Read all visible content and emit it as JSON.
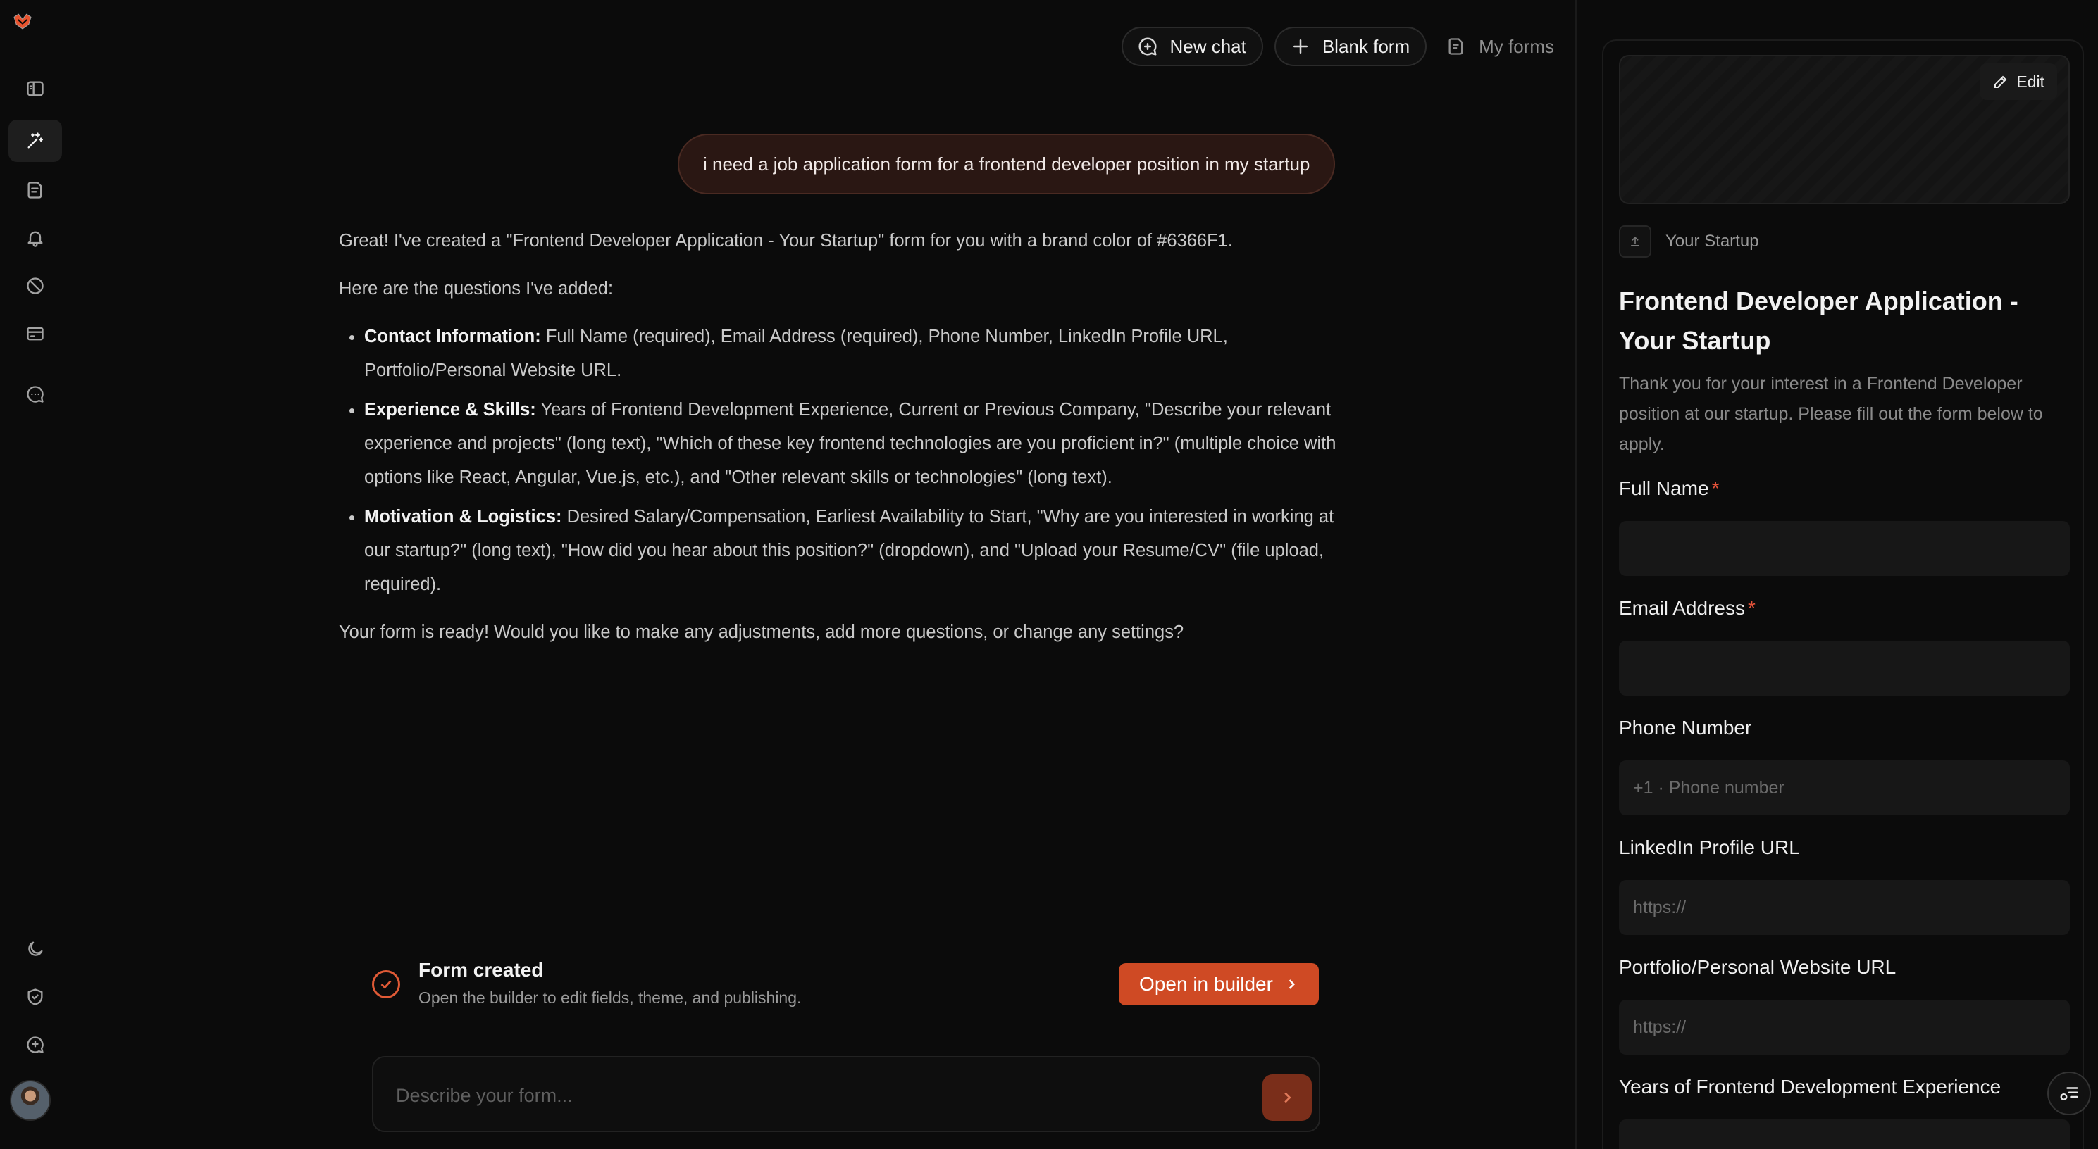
{
  "app": {
    "accent_color": "#cf4a24",
    "logo_icon": "brand-logo"
  },
  "rail": {
    "items": [
      "sidebar-toggle-icon",
      "ai-sparkle-icon",
      "forms-icon",
      "bell-icon",
      "slash-tag-icon",
      "card-icon",
      "chat-bubble-icon"
    ],
    "bottom_items": [
      "moon-icon",
      "shield-check-icon",
      "feedback-icon"
    ],
    "active_index": 1
  },
  "topbar": {
    "new_chat": "New chat",
    "blank_form": "Blank form",
    "my_forms": "My forms"
  },
  "chat": {
    "user_message": "i need a job application form for a frontend developer position in my startup",
    "intro": "Great! I've created a \"Frontend Developer Application - Your Startup\" form for you with a brand color of #6366F1.",
    "questions_heading": "Here are the questions I've added:",
    "sections": [
      {
        "title": "Contact Information:",
        "text": " Full Name (required), Email Address (required), Phone Number, LinkedIn Profile URL, Portfolio/Personal Website URL."
      },
      {
        "title": "Experience & Skills:",
        "text": " Years of Frontend Development Experience, Current or Previous Company, \"Describe your relevant experience and projects\" (long text), \"Which of these key frontend technologies are you proficient in?\" (multiple choice with options like React, Angular, Vue.js, etc.), and \"Other relevant skills or technologies\" (long text)."
      },
      {
        "title": "Motivation & Logistics:",
        "text": " Desired Salary/Compensation, Earliest Availability to Start, \"Why are you interested in working at our startup?\" (long text), \"How did you hear about this position?\" (dropdown), and \"Upload your Resume/CV\" (file upload, required)."
      }
    ],
    "closing": "Your form is ready! Would you like to make any adjustments, add more questions, or change any settings?"
  },
  "created_card": {
    "title": "Form created",
    "subtitle": "Open the builder to edit fields, theme, and publishing.",
    "button": "Open in builder"
  },
  "prompt": {
    "placeholder": "Describe your form...",
    "value": ""
  },
  "preview": {
    "edit_label": "Edit",
    "brand_name": "Your Startup",
    "title": "Frontend Developer Application - Your Startup",
    "description": "Thank you for your interest in a Frontend Developer position at our startup. Please fill out the form below to apply.",
    "required_mark": "*",
    "fields": [
      {
        "label": "Full Name",
        "required": true,
        "placeholder": ""
      },
      {
        "label": "Email Address",
        "required": true,
        "placeholder": ""
      },
      {
        "label": "Phone Number",
        "required": false,
        "placeholder": "+1 · Phone number"
      },
      {
        "label": "LinkedIn Profile URL",
        "required": false,
        "placeholder": "https://"
      },
      {
        "label": "Portfolio/Personal Website URL",
        "required": false,
        "placeholder": "https://"
      },
      {
        "label": "Years of Frontend Development Experience",
        "required": false,
        "placeholder": ""
      }
    ]
  }
}
